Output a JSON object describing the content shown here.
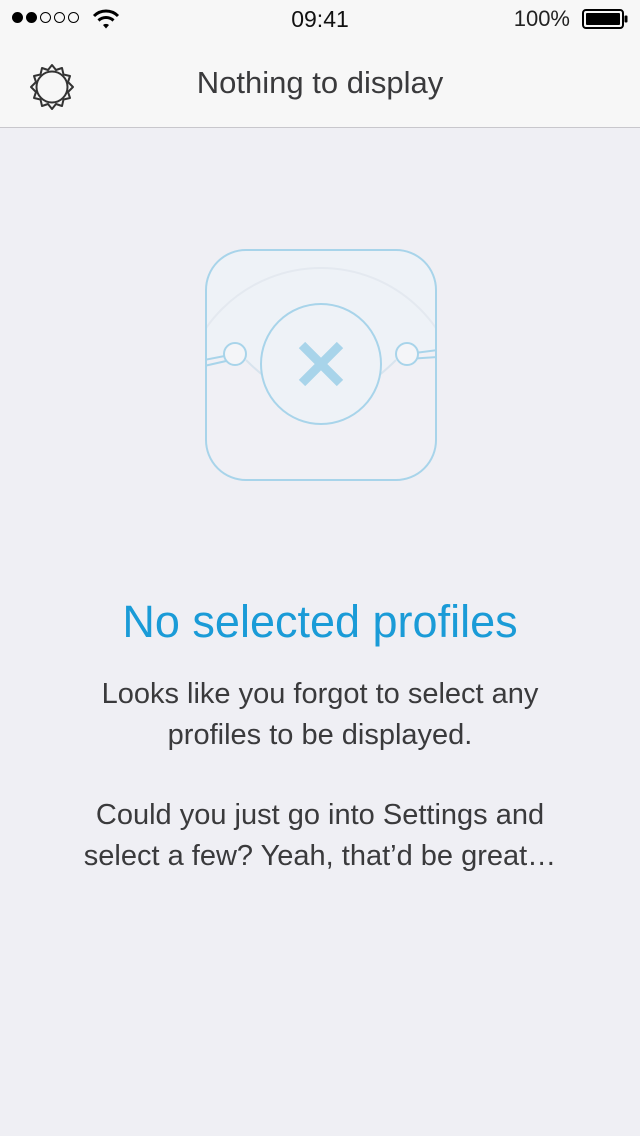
{
  "status_bar": {
    "time": "09:41",
    "battery_percent": "100%",
    "signal_strength": 2,
    "icons": [
      "signal-dots-icon",
      "wifi-icon",
      "battery-icon"
    ]
  },
  "nav_bar": {
    "title": "Nothing to display",
    "settings_icon": "gear-icon"
  },
  "empty_state": {
    "illustration_icon": "app-icon-with-x",
    "title": "No selected profiles",
    "message_lines_1": [
      "Looks like you forgot to select any",
      "profiles to be displayed."
    ],
    "message_lines_2": [
      "Could you just go into Settings and",
      "select a few? Yeah, that’d be great…"
    ]
  },
  "colors": {
    "accent": "#1a9bd7",
    "illustration_stroke": "#a8d4ea",
    "background": "#efeff4",
    "bar_background": "#f7f7f7",
    "text": "#3a3a3c"
  }
}
